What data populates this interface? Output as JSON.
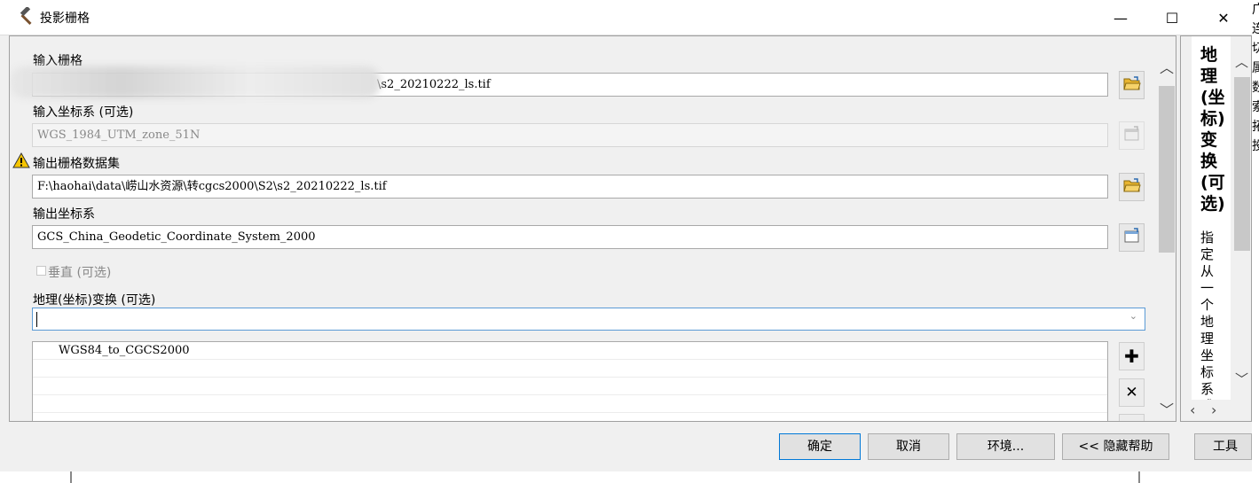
{
  "window": {
    "title": "投影栅格",
    "minimize": "—",
    "maximize": "☐",
    "close": "✕"
  },
  "form": {
    "input_raster": {
      "label": "输入栅格",
      "value": "\\s2_20210222_ls.tif"
    },
    "input_crs": {
      "label": "输入坐标系 (可选)",
      "value": "WGS_1984_UTM_zone_51N"
    },
    "output_raster": {
      "label": "输出栅格数据集",
      "value": "F:\\haohai\\data\\崂山水资源\\转cgcs2000\\S2\\s2_20210222_ls.tif"
    },
    "output_crs": {
      "label": "输出坐标系",
      "value": "GCS_China_Geodetic_Coordinate_System_2000"
    },
    "vertical": {
      "label": "垂直 (可选)"
    },
    "geo_transform": {
      "label": "地理(坐标)变换 (可选)",
      "value": "",
      "list": [
        "WGS84_to_CGCS2000",
        "",
        "",
        "",
        ""
      ]
    },
    "add_label": "✚",
    "remove_label": "✕"
  },
  "help": {
    "title": "地理(坐标)变换(可选)",
    "body": "指定从一个地理坐标系或其"
  },
  "buttons": {
    "ok": "确定",
    "cancel": "取消",
    "environments": "环境...",
    "hide_help": "<< 隐藏帮助",
    "tool_help": "工具"
  },
  "background": {
    "right_edge_text": "广\n连\n切\n属\n数\n索\n拓\n投"
  },
  "colors": {
    "accent": "#0078d7",
    "warning": "#f5c400"
  }
}
